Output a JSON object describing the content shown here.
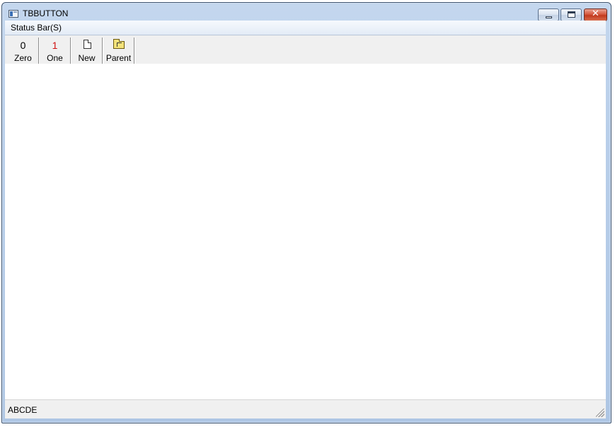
{
  "window": {
    "title": "TBBUTTON"
  },
  "menu": {
    "items": [
      {
        "label": "Status Bar(S)"
      }
    ]
  },
  "toolbar": {
    "buttons": [
      {
        "label": "Zero",
        "glyph": "0",
        "icon": "digit-zero-icon"
      },
      {
        "label": "One",
        "glyph": "1",
        "icon": "digit-one-icon",
        "glyph_color": "#d01010"
      },
      {
        "label": "New",
        "icon": "new-document-icon"
      },
      {
        "label": "Parent",
        "icon": "parent-folder-icon"
      }
    ]
  },
  "statusbar": {
    "text": "ABCDE"
  },
  "colors": {
    "toolbar_bg": "#f0f0f0",
    "client_bg": "#ffffff",
    "close_button": "#c23a1f"
  }
}
